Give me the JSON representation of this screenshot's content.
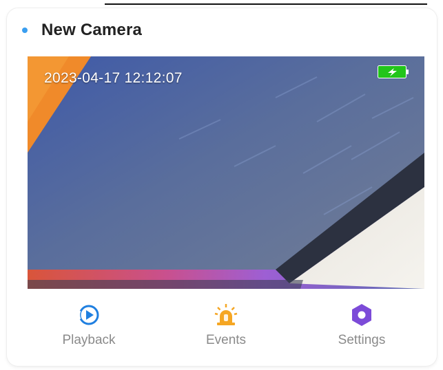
{
  "camera": {
    "name": "New Camera",
    "status_color": "#3a9ef0",
    "timestamp": "2023-04-17 12:12:07",
    "battery": {
      "icon": "battery-charging-icon",
      "color": "#22c51a",
      "charging": true
    }
  },
  "actions": [
    {
      "label": "Playback",
      "icon": "playback-icon",
      "color": "#1f7fe0"
    },
    {
      "label": "Events",
      "icon": "alarm-icon",
      "color": "#f5a623"
    },
    {
      "label": "Settings",
      "icon": "settings-icon",
      "color": "#7c4bd8"
    }
  ]
}
